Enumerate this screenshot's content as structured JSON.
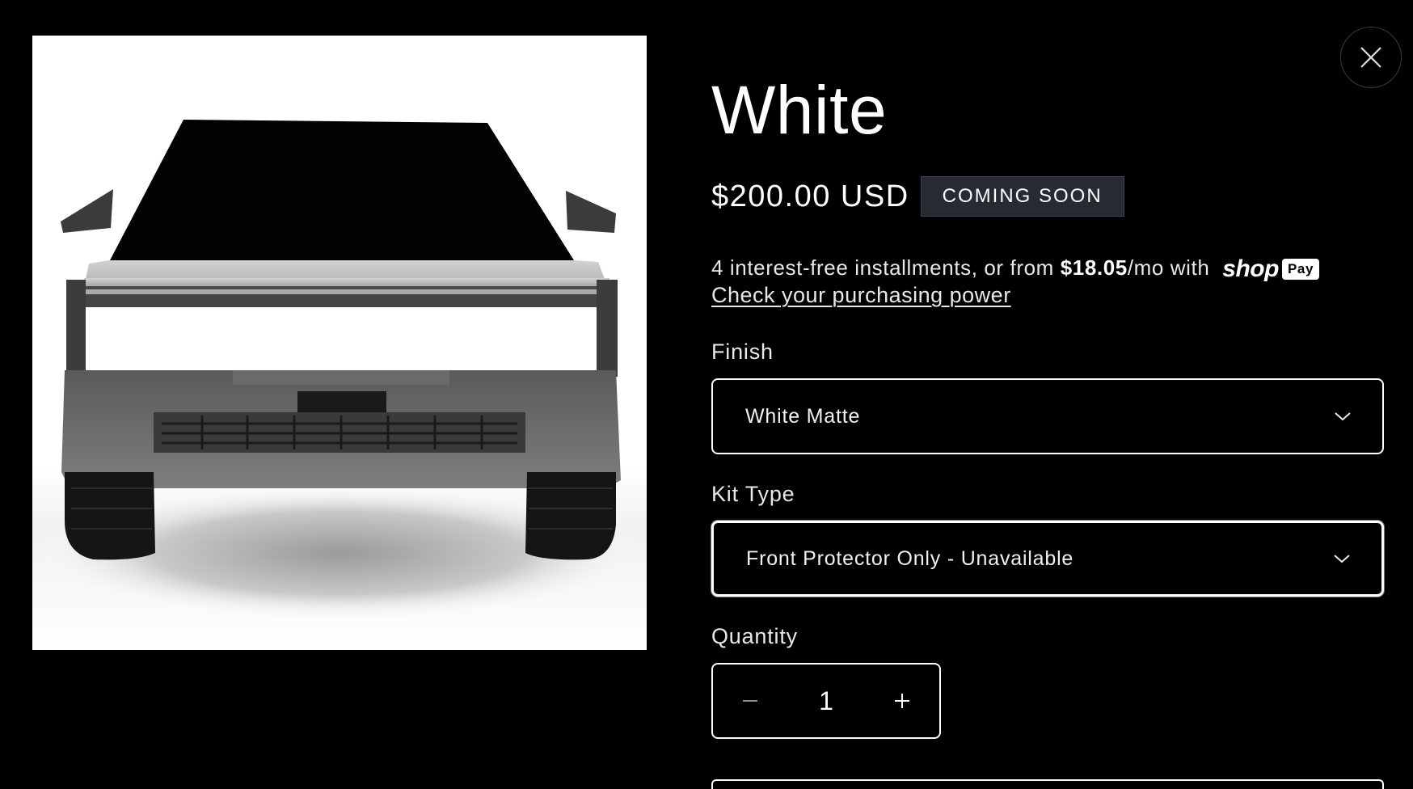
{
  "product": {
    "title": "White",
    "price": "$200.00 USD",
    "badge": "COMING SOON",
    "image_alt": "Cybertruck front view"
  },
  "installments": {
    "prefix": "4 interest-free installments, or from ",
    "amount": "$18.05",
    "suffix": "/mo with",
    "provider_word": "shop",
    "provider_chip": "Pay",
    "link": "Check your purchasing power"
  },
  "finish": {
    "label": "Finish",
    "selected": "White Matte"
  },
  "kit_type": {
    "label": "Kit Type",
    "selected": "Front Protector Only - Unavailable"
  },
  "quantity": {
    "label": "Quantity",
    "value": "1"
  },
  "icons": {
    "close": "close-icon",
    "chevron": "chevron-down-icon",
    "minus": "minus-icon",
    "plus": "plus-icon"
  },
  "colors": {
    "background": "#000000",
    "text": "#ffffff",
    "badge_bg": "#252a33"
  }
}
